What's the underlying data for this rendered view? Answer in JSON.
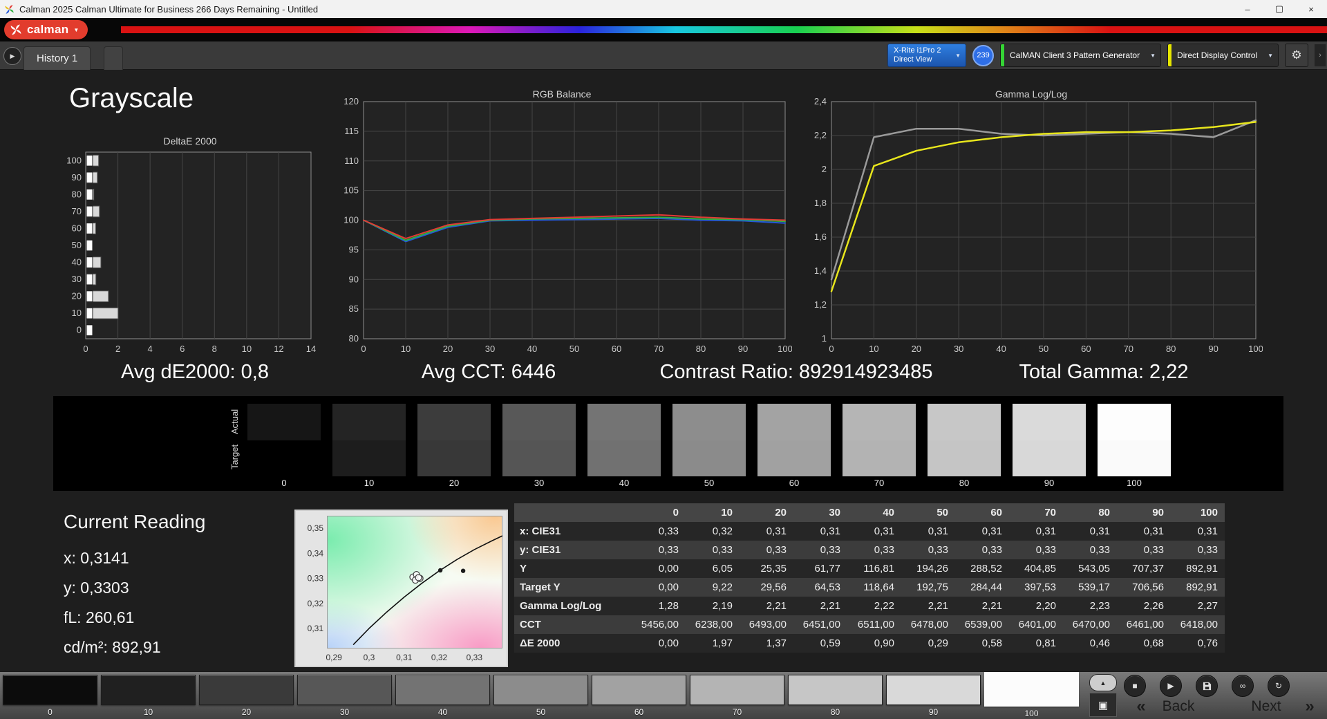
{
  "titlebar": {
    "title": "Calman 2025 Calman Ultimate for Business 266 Days Remaining  - Untitled",
    "minimize": "–",
    "maximize": "▢",
    "close": "×"
  },
  "header": {
    "logo_text": "calman",
    "logo_caret": "▼"
  },
  "tabs": {
    "nav_icon": "▶",
    "history_label": "History 1"
  },
  "toolbar": {
    "meter_line1": "X-Rite i1Pro 2",
    "meter_line2": "Direct View",
    "badge": "239",
    "pattern_label": "CalMAN Client 3 Pattern Generator",
    "display_label": "Direct Display Control",
    "gear_icon": "⚙",
    "caret": "▼",
    "panel_caret": "›"
  },
  "page": {
    "title": "Grayscale"
  },
  "stats": {
    "avg_de": "Avg dE2000: 0,8",
    "avg_cct": "Avg CCT: 6446",
    "contrast": "Contrast Ratio: 892914923485",
    "total_gamma": "Total Gamma: 2,22"
  },
  "chart_data": [
    {
      "id": "deltae",
      "type": "bar",
      "title": "DeltaE 2000",
      "orientation": "horizontal",
      "categories": [
        100,
        90,
        80,
        70,
        60,
        50,
        40,
        30,
        20,
        10,
        0
      ],
      "values": [
        0.76,
        0.68,
        0.46,
        0.81,
        0.58,
        0.29,
        0.9,
        0.59,
        1.37,
        1.97,
        0.0
      ],
      "xlim": [
        0,
        14
      ],
      "xticks": [
        0,
        2,
        4,
        6,
        8,
        10,
        12,
        14
      ],
      "bar_color": "#d9d9d9",
      "grid": true
    },
    {
      "id": "rgb_balance",
      "type": "line",
      "title": "RGB Balance",
      "x": [
        0,
        10,
        20,
        30,
        40,
        50,
        60,
        70,
        80,
        90,
        100
      ],
      "ylim": [
        80,
        120
      ],
      "yticks": [
        80,
        85,
        90,
        95,
        100,
        105,
        110,
        115,
        120
      ],
      "grid": true,
      "series": [
        {
          "name": "Blue",
          "color": "#2458d8",
          "values": [
            100,
            96.4,
            98.8,
            99.9,
            100.0,
            100.1,
            100.2,
            100.3,
            100.0,
            99.9,
            99.5
          ]
        },
        {
          "name": "Green",
          "color": "#2fae3e",
          "values": [
            100,
            96.6,
            99.0,
            100.0,
            100.2,
            100.3,
            100.4,
            100.5,
            100.2,
            100.1,
            99.8
          ]
        },
        {
          "name": "Red",
          "color": "#e23b35",
          "values": [
            100,
            96.9,
            99.2,
            100.1,
            100.3,
            100.5,
            100.7,
            100.9,
            100.5,
            100.2,
            100.0
          ]
        }
      ]
    },
    {
      "id": "gamma",
      "type": "line",
      "title": "Gamma Log/Log",
      "x": [
        0,
        10,
        20,
        30,
        40,
        50,
        60,
        70,
        80,
        90,
        100
      ],
      "ylim": [
        1,
        2.4
      ],
      "yticks": [
        1,
        1.2,
        1.4,
        1.6,
        1.8,
        2,
        2.2,
        2.4
      ],
      "ytick_labels": [
        "1",
        "1,2",
        "1,4",
        "1,6",
        "1,8",
        "2",
        "2,2",
        "2,4"
      ],
      "grid": true,
      "series": [
        {
          "name": "Reference",
          "color": "#9a9a9a",
          "width": 2.5,
          "values": [
            1.35,
            2.19,
            2.24,
            2.24,
            2.21,
            2.2,
            2.21,
            2.22,
            2.21,
            2.19,
            2.29
          ]
        },
        {
          "name": "Measured Gamma",
          "color": "#e8e61c",
          "width": 2.5,
          "values": [
            1.28,
            2.02,
            2.11,
            2.16,
            2.19,
            2.21,
            2.22,
            2.22,
            2.23,
            2.25,
            2.28
          ]
        }
      ]
    }
  ],
  "swatch_strip": {
    "row_labels": [
      "Actual",
      "Target"
    ],
    "levels": [
      "0",
      "10",
      "20",
      "30",
      "40",
      "50",
      "60",
      "70",
      "80",
      "90",
      "100"
    ],
    "actual_colors": [
      "#161616",
      "#242424",
      "#3c3c3c",
      "#585858",
      "#747474",
      "#8d8d8d",
      "#a3a3a3",
      "#b5b5b5",
      "#c7c7c7",
      "#dadada",
      "#fdfdfd"
    ],
    "target_colors": [
      "#000000",
      "#1d1d1d",
      "#383838",
      "#555555",
      "#717171",
      "#8b8b8b",
      "#a1a1a1",
      "#b3b3b3",
      "#c5c5c5",
      "#d8d8d8",
      "#fafafa"
    ]
  },
  "current_reading": {
    "title": "Current Reading",
    "x": "x: 0,3141",
    "y": "y: 0,3303",
    "fl": "fL: 260,61",
    "cdm2": "cd/m²: 892,91"
  },
  "cie": {
    "xlim": [
      0.288,
      0.338
    ],
    "ylim": [
      0.302,
      0.355
    ],
    "xticks": [
      {
        "v": 0.29,
        "label": "0,29"
      },
      {
        "v": 0.3,
        "label": "0,3"
      },
      {
        "v": 0.31,
        "label": "0,31"
      },
      {
        "v": 0.32,
        "label": "0,32"
      },
      {
        "v": 0.33,
        "label": "0,33"
      }
    ],
    "yticks": [
      {
        "v": 0.35,
        "label": "0,35"
      },
      {
        "v": 0.34,
        "label": "0,34"
      },
      {
        "v": 0.33,
        "label": "0,33"
      },
      {
        "v": 0.32,
        "label": "0,32"
      },
      {
        "v": 0.31,
        "label": "0,31"
      }
    ],
    "locus": [
      [
        0.2955,
        0.3035
      ],
      [
        0.3,
        0.31
      ],
      [
        0.305,
        0.3165
      ],
      [
        0.31,
        0.3225
      ],
      [
        0.315,
        0.328
      ],
      [
        0.32,
        0.333
      ],
      [
        0.325,
        0.3375
      ],
      [
        0.33,
        0.3415
      ],
      [
        0.335,
        0.345
      ],
      [
        0.338,
        0.347
      ]
    ],
    "points_open": [
      [
        0.3125,
        0.3305
      ],
      [
        0.3135,
        0.3315
      ],
      [
        0.3145,
        0.33
      ],
      [
        0.3132,
        0.3293
      ],
      [
        0.3141,
        0.3303
      ]
    ],
    "points_filled": [
      [
        0.3203,
        0.3332
      ],
      [
        0.3268,
        0.333
      ]
    ]
  },
  "table": {
    "col_headers": [
      "",
      "0",
      "10",
      "20",
      "30",
      "40",
      "50",
      "60",
      "70",
      "80",
      "90",
      "100"
    ],
    "rows": [
      {
        "label": "x: CIE31",
        "values": [
          "0,33",
          "0,32",
          "0,31",
          "0,31",
          "0,31",
          "0,31",
          "0,31",
          "0,31",
          "0,31",
          "0,31",
          "0,31"
        ]
      },
      {
        "label": "y: CIE31",
        "values": [
          "0,33",
          "0,33",
          "0,33",
          "0,33",
          "0,33",
          "0,33",
          "0,33",
          "0,33",
          "0,33",
          "0,33",
          "0,33"
        ]
      },
      {
        "label": "Y",
        "values": [
          "0,00",
          "6,05",
          "25,35",
          "61,77",
          "116,81",
          "194,26",
          "288,52",
          "404,85",
          "543,05",
          "707,37",
          "892,91"
        ]
      },
      {
        "label": "Target Y",
        "values": [
          "0,00",
          "9,22",
          "29,56",
          "64,53",
          "118,64",
          "192,75",
          "284,44",
          "397,53",
          "539,17",
          "706,56",
          "892,91"
        ]
      },
      {
        "label": "Gamma Log/Log",
        "values": [
          "1,28",
          "2,19",
          "2,21",
          "2,21",
          "2,22",
          "2,21",
          "2,21",
          "2,20",
          "2,23",
          "2,26",
          "2,27"
        ]
      },
      {
        "label": "CCT",
        "values": [
          "5456,00",
          "6238,00",
          "6493,00",
          "6451,00",
          "6511,00",
          "6478,00",
          "6539,00",
          "6401,00",
          "6470,00",
          "6461,00",
          "6418,00"
        ]
      },
      {
        "label": "ΔE 2000",
        "values": [
          "0,00",
          "1,97",
          "1,37",
          "0,59",
          "0,90",
          "0,29",
          "0,58",
          "0,81",
          "0,46",
          "0,68",
          "0,76"
        ]
      }
    ]
  },
  "bottom_bar": {
    "levels": [
      "0",
      "10",
      "20",
      "30",
      "40",
      "50",
      "60",
      "70",
      "80",
      "90",
      "100"
    ],
    "colors": [
      "#0c0c0c",
      "#202020",
      "#3a3a3a",
      "#575757",
      "#737373",
      "#8c8c8c",
      "#a2a2a2",
      "#b4b4b4",
      "#c6c6c6",
      "#d9d9d9",
      "#fcfcfc"
    ],
    "active_level": "100",
    "transport": {
      "up": "▲",
      "pattern_window": "▣",
      "stop": "■",
      "play": "▶",
      "link": "∞",
      "refresh": "↻",
      "back_chevrons": "«",
      "back": "Back",
      "next": "Next",
      "next_chevrons": "»"
    }
  }
}
